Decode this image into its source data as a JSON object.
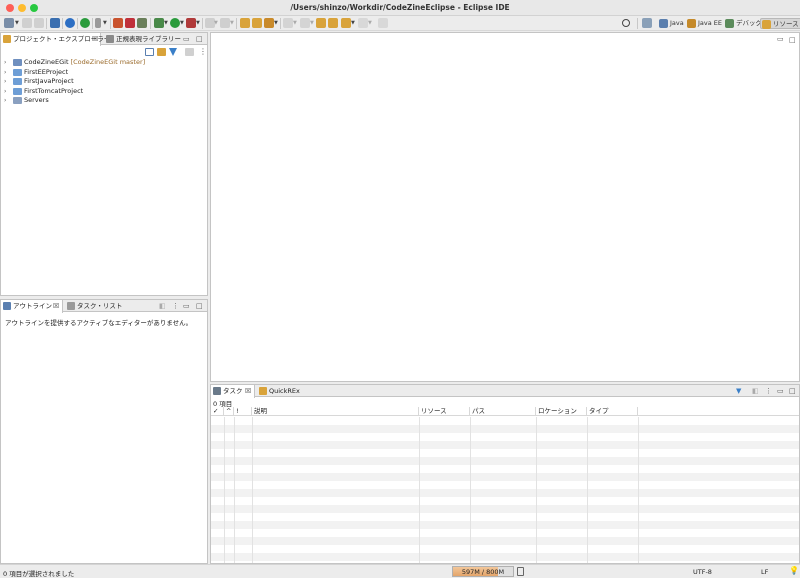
{
  "window": {
    "title": "/Users/shinzo/Workdir/CodeZineEclipse - Eclipse IDE"
  },
  "toolbar": {
    "perspectives": [
      {
        "label": "Java",
        "icon": "java-perspective-icon",
        "active": false
      },
      {
        "label": "Java EE",
        "icon": "javaee-perspective-icon",
        "active": false
      },
      {
        "label": "デバッグ",
        "icon": "debug-perspective-icon",
        "active": false
      },
      {
        "label": "リソース",
        "icon": "resource-perspective-icon",
        "active": true
      }
    ]
  },
  "project_explorer": {
    "tabs": [
      {
        "label": "プロジェクト・エクスプローラー",
        "icon": "project-explorer-icon"
      },
      {
        "label": "正規表現ライブラリー",
        "icon": "regex-library-icon"
      }
    ],
    "items": [
      {
        "label": "CodeZineEGit",
        "decoration": "[CodeZineEGit master]"
      },
      {
        "label": "FirstEEProject",
        "decoration": ""
      },
      {
        "label": "FirstJavaProject",
        "decoration": ""
      },
      {
        "label": "FirstTomcatProject",
        "decoration": ""
      },
      {
        "label": "Servers",
        "decoration": ""
      }
    ]
  },
  "outline": {
    "tabs": [
      {
        "label": "アウトライン",
        "icon": "outline-icon"
      },
      {
        "label": "タスク・リスト",
        "icon": "task-list-icon"
      }
    ],
    "message": "アウトラインを提供するアクティブなエディターがありません。"
  },
  "tasks": {
    "tabs": [
      {
        "label": "タスク",
        "icon": "tasks-icon"
      },
      {
        "label": "QuickREx",
        "icon": "quickrex-icon"
      }
    ],
    "count": "0 項目",
    "columns": [
      "✓",
      "^",
      "!",
      "説明",
      "リソース",
      "パス",
      "ロケーション",
      "タイプ"
    ]
  },
  "statusbar": {
    "selection": "0 項目が選択されました",
    "heap": "597M / 800M",
    "heap_used_fraction": 0.746,
    "encoding": "UTF-8",
    "line_ending": "LF"
  }
}
